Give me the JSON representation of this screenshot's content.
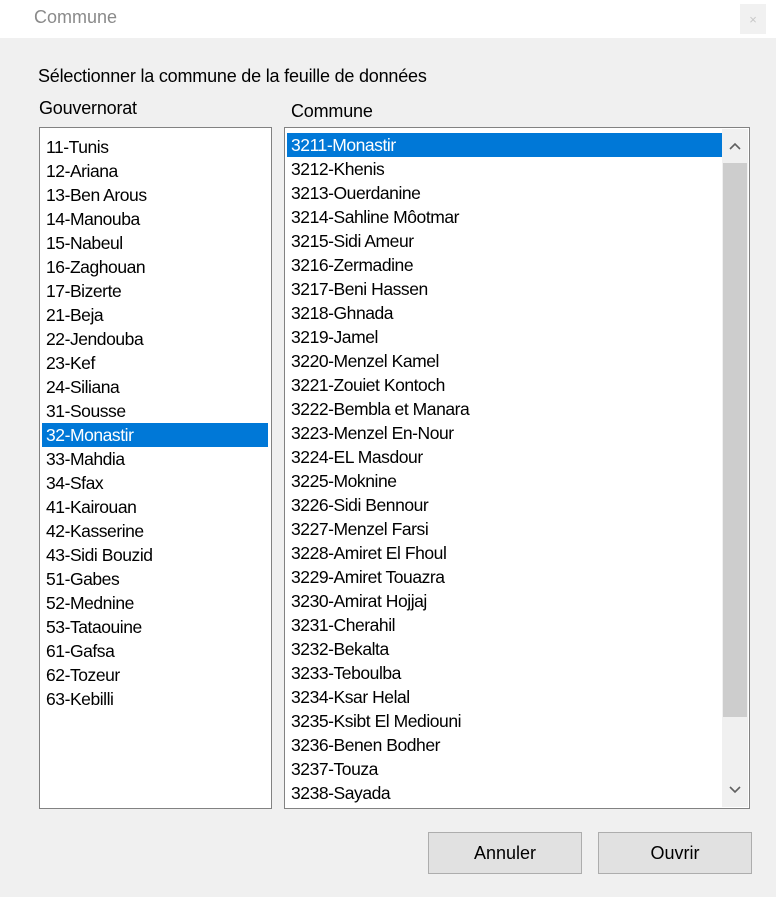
{
  "window": {
    "title": "Commune",
    "close_glyph": "×"
  },
  "dialog": {
    "instruction": "Sélectionner la commune de la feuille de données",
    "gouvernorat_label": "Gouvernorat",
    "commune_label": "Commune"
  },
  "gouvernorats": [
    "11-Tunis",
    "12-Ariana",
    "13-Ben Arous",
    "14-Manouba",
    "15-Nabeul",
    "16-Zaghouan",
    "17-Bizerte",
    "21-Beja",
    "22-Jendouba",
    "23-Kef",
    "24-Siliana",
    "31-Sousse",
    "32-Monastir",
    "33-Mahdia",
    "34-Sfax",
    "41-Kairouan",
    "42-Kasserine",
    "43-Sidi Bouzid",
    "51-Gabes",
    "52-Mednine",
    "53-Tataouine",
    "61-Gafsa",
    "62-Tozeur",
    "63-Kebilli"
  ],
  "selected_gouvernorat": "32-Monastir",
  "communes": [
    "3211-Monastir",
    "3212-Khenis",
    "3213-Ouerdanine",
    "3214-Sahline Môotmar",
    "3215-Sidi Ameur",
    "3216-Zermadine",
    "3217-Beni Hassen",
    "3218-Ghnada",
    "3219-Jamel",
    "3220-Menzel Kamel",
    "3221-Zouiet Kontoch",
    "3222-Bembla et Manara",
    "3223-Menzel En-Nour",
    "3224-EL Masdour",
    "3225-Moknine",
    "3226-Sidi Bennour",
    "3227-Menzel Farsi",
    "3228-Amiret El Fhoul",
    "3229-Amiret Touazra",
    "3230-Amirat Hojjaj",
    "3231-Cherahil",
    "3232-Bekalta",
    "3233-Teboulba",
    "3234-Ksar Helal",
    "3235-Ksibt El Mediouni",
    "3236-Benen Bodher",
    "3237-Touza",
    "3238-Sayada"
  ],
  "selected_commune": "3211-Monastir",
  "buttons": {
    "cancel": "Annuler",
    "open": "Ouvrir"
  },
  "colors": {
    "selection": "#0078d7",
    "dialog_background": "#f0f0f0"
  },
  "icons": {
    "scroll_up": "chevron-up-icon",
    "scroll_down": "chevron-down-icon"
  }
}
